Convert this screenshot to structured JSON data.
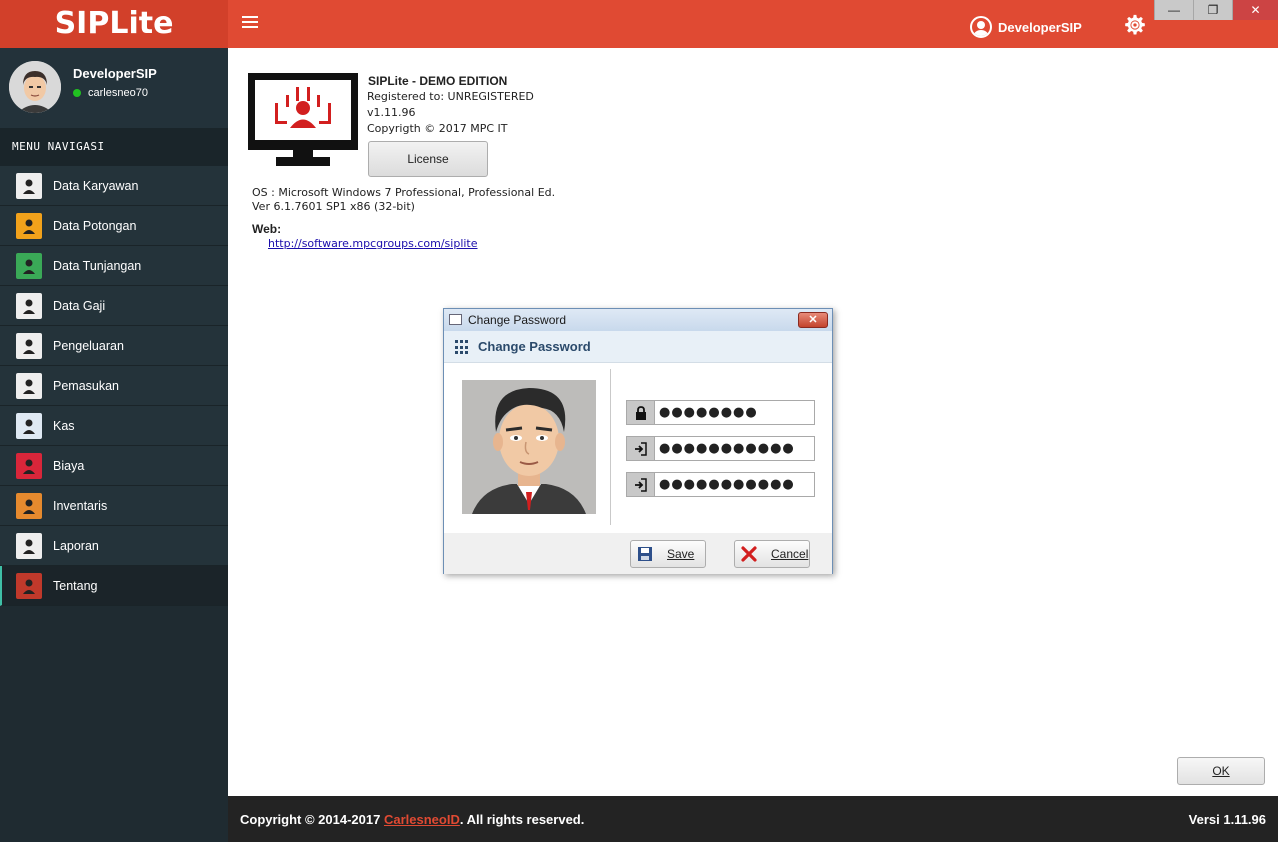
{
  "app": {
    "brand": "SIPLite"
  },
  "topbar": {
    "menu_icon": "hamburger-icon",
    "username": "DeveloperSIP",
    "user_icon": "user-circle-icon",
    "settings_icon": "gear-icon"
  },
  "window_controls": {
    "minimize": "—",
    "maximize": "❐",
    "close": "✕"
  },
  "profile": {
    "name": "DeveloperSIP",
    "status": "carlesneo70",
    "status_color": "#21c121"
  },
  "menu": {
    "heading": "MENU NAVIGASI",
    "items": [
      {
        "label": "Data Karyawan",
        "icon": "people-icon",
        "color": "#eeeeee"
      },
      {
        "label": "Data Potongan",
        "icon": "money-bag-icon",
        "color": "#f2a21b"
      },
      {
        "label": "Data Tunjangan",
        "icon": "calculator-icon",
        "color": "#3aa957"
      },
      {
        "label": "Data Gaji",
        "icon": "salary-person-icon",
        "color": "#eeeeee"
      },
      {
        "label": "Pengeluaran",
        "icon": "money-out-icon",
        "color": "#eeeeee"
      },
      {
        "label": "Pemasukan",
        "icon": "money-in-icon",
        "color": "#eeeeee"
      },
      {
        "label": "Kas",
        "icon": "cash-register-icon",
        "color": "#dfe9f3"
      },
      {
        "label": "Biaya",
        "icon": "cost-hand-icon",
        "color": "#d9263a"
      },
      {
        "label": "Inventaris",
        "icon": "boxes-icon",
        "color": "#e68a2e"
      },
      {
        "label": "Laporan",
        "icon": "report-icon",
        "color": "#eeeeee"
      },
      {
        "label": "Tentang",
        "icon": "info-icon",
        "color": "#c0392b",
        "active": true
      }
    ]
  },
  "about": {
    "title": "SIPLite - DEMO EDITION",
    "registered": "Registered to: UNREGISTERED",
    "version": "v1.11.96",
    "copyright": "Copyrigth © 2017 MPC IT",
    "license_button": "License",
    "os": "OS : Microsoft Windows 7 Professional, Professional Ed.",
    "os_ver": "Ver 6.1.7601 SP1 x86 (32-bit)",
    "web_label": "Web:",
    "web_link": "http://software.mpcgroups.com/siplite",
    "ok_button": "OK"
  },
  "dialog": {
    "window_title": "Change Password",
    "header": "Change Password",
    "close": "✕",
    "fields": [
      {
        "icon": "lock-icon",
        "value": "●●●●●●●●"
      },
      {
        "icon": "login-arrow-icon",
        "value": "●●●●●●●●●●●"
      },
      {
        "icon": "login-arrow-icon",
        "value": "●●●●●●●●●●●"
      }
    ],
    "save_button": "Save",
    "cancel_button": "Cancel"
  },
  "footer": {
    "copyright_pre": "Copyright © 2014-2017 ",
    "copyright_link": "CarlesneoID",
    "copyright_post": ". All rights reserved.",
    "version": "Versi 1.11.96"
  }
}
